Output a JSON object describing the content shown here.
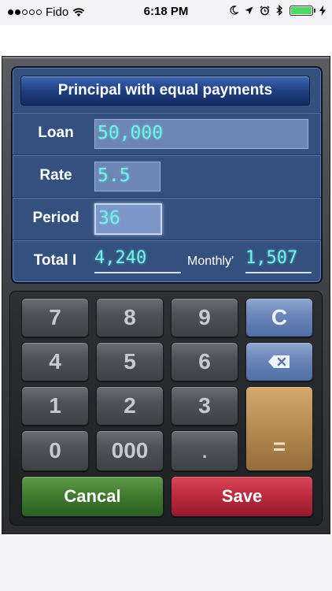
{
  "status_bar": {
    "carrier": "Fido",
    "time": "6:18 PM",
    "signal_dots_filled": 2,
    "signal_dots_total": 5,
    "icons": [
      "wifi-icon",
      "moon-icon",
      "location-icon",
      "alarm-icon",
      "bluetooth-icon",
      "battery-icon",
      "charging-icon"
    ],
    "battery_level": 1.0,
    "battery_color": "#4cd964"
  },
  "calculator": {
    "title": "Principal with equal payments",
    "fields": {
      "loan": {
        "label": "Loan",
        "value": "50,000"
      },
      "rate": {
        "label": "Rate",
        "value": "5.5"
      },
      "period": {
        "label": "Period",
        "value": "36"
      },
      "total": {
        "label": "Total I",
        "value": "4,240"
      },
      "monthly": {
        "label": "Monthly'",
        "value": "1,507"
      }
    }
  },
  "keypad": {
    "keys": {
      "k7": "7",
      "k8": "8",
      "k9": "9",
      "k4": "4",
      "k5": "5",
      "k6": "6",
      "k1": "1",
      "k2": "2",
      "k3": "3",
      "k0": "0",
      "k000": "000",
      "dot": ".",
      "clear": "C",
      "equals": "="
    },
    "cancel": "Cancal",
    "save": "Save"
  },
  "colors": {
    "panel_blue": "#34507f",
    "lcd_text": "#6ff2e6",
    "cancel_green": "#3f7a2f",
    "save_red": "#bb2a3e",
    "equals_gold": "#b98e54",
    "action_blue": "#6a86b8"
  }
}
